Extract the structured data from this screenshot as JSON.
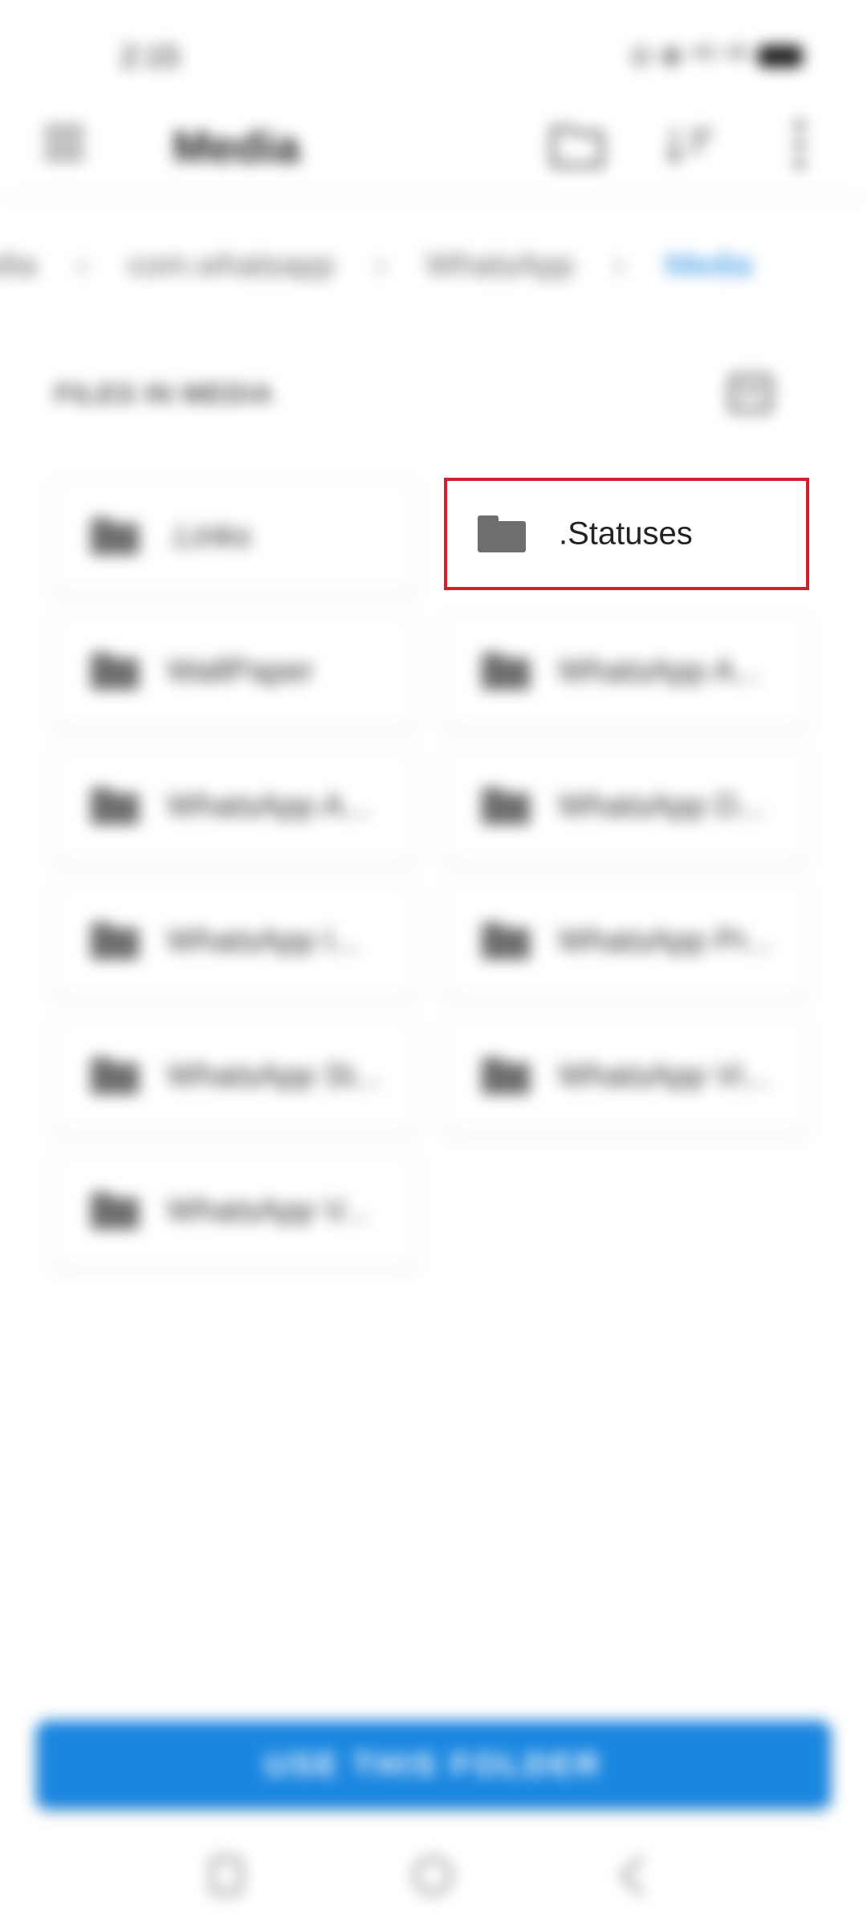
{
  "status_bar": {
    "time": "2:15",
    "icons_text": "⊙ ⊕ ⁵ᴳ ⁴ᴳ"
  },
  "app_bar": {
    "title": "Media"
  },
  "breadcrumb": [
    {
      "label": "edia"
    },
    {
      "label": "com.whatsapp"
    },
    {
      "label": "WhatsApp"
    },
    {
      "label": "Media"
    }
  ],
  "section": {
    "title": "FILES IN MEDIA"
  },
  "folders": [
    {
      "label": ".Links"
    },
    {
      "label": ".Statuses"
    },
    {
      "label": "WallPaper"
    },
    {
      "label": "WhatsApp A..."
    },
    {
      "label": "WhatsApp A..."
    },
    {
      "label": "WhatsApp D..."
    },
    {
      "label": "WhatsApp I..."
    },
    {
      "label": "WhatsApp Pr..."
    },
    {
      "label": "WhatsApp St..."
    },
    {
      "label": "WhatsApp Vi..."
    },
    {
      "label": "WhatsApp V..."
    }
  ],
  "button": {
    "label": "USE THIS FOLDER"
  },
  "colors": {
    "accent": "#1a86e0",
    "highlight_border": "#d0222d"
  }
}
